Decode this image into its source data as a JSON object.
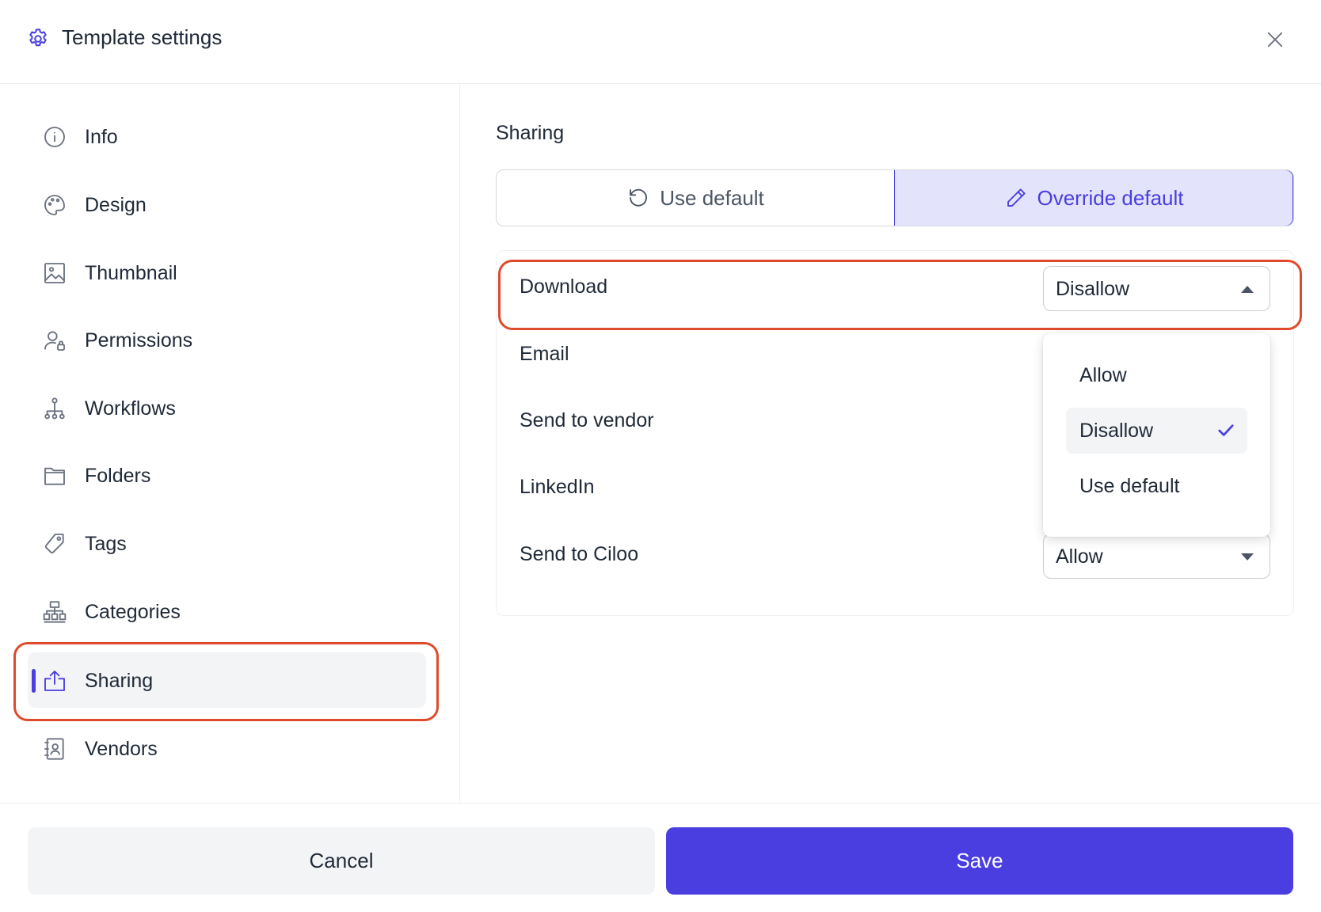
{
  "header": {
    "title": "Template settings"
  },
  "sidebar": {
    "items": [
      {
        "label": "Info"
      },
      {
        "label": "Design"
      },
      {
        "label": "Thumbnail"
      },
      {
        "label": "Permissions"
      },
      {
        "label": "Workflows"
      },
      {
        "label": "Folders"
      },
      {
        "label": "Tags"
      },
      {
        "label": "Categories"
      },
      {
        "label": "Sharing",
        "active": true
      },
      {
        "label": "Vendors"
      }
    ]
  },
  "main": {
    "section_title": "Sharing",
    "mode": {
      "use_default_label": "Use default",
      "override_default_label": "Override default",
      "selected": "Override default"
    },
    "rows": [
      {
        "label": "Download",
        "value": "Disallow"
      },
      {
        "label": "Email"
      },
      {
        "label": "Send to vendor"
      },
      {
        "label": "LinkedIn"
      },
      {
        "label": "Send to Ciloo",
        "value": "Allow"
      }
    ],
    "dropdown": {
      "options": [
        "Allow",
        "Disallow",
        "Use default"
      ],
      "selected": "Disallow"
    }
  },
  "footer": {
    "cancel_label": "Cancel",
    "save_label": "Save"
  },
  "colors": {
    "accent": "#4a3ee0",
    "highlight": "#e04a2c",
    "selected_bg": "#e3e3fb"
  }
}
